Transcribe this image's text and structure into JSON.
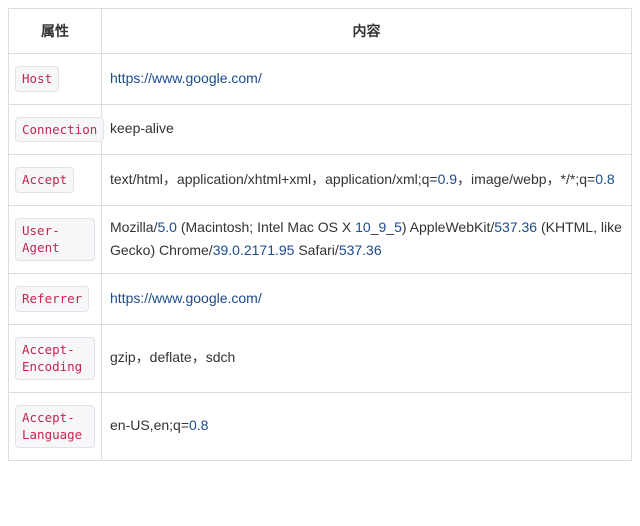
{
  "headers": {
    "attribute": "属性",
    "content": "内容"
  },
  "rows": [
    {
      "attr": "Host",
      "content": "https://www.google.com/",
      "isLink": true
    },
    {
      "attr": "Connection",
      "content": "keep-alive",
      "isLink": false
    },
    {
      "attr": "Accept",
      "content": "text/html，application/xhtml+xml，application/xml;q=0.9，image/webp，*/*;q=0.8",
      "isLink": false
    },
    {
      "attr": "User-Agent",
      "content": "Mozilla/5.0 (Macintosh; Intel Mac OS X 10_9_5) AppleWebKit/537.36 (KHTML, like Gecko) Chrome/39.0.2171.95 Safari/537.36",
      "isLink": false
    },
    {
      "attr": "Referrer",
      "content": "https://www.google.com/",
      "isLink": true
    },
    {
      "attr": "Accept-Encoding",
      "content": "gzip，deflate，sdch",
      "isLink": false
    },
    {
      "attr": "Accept-Language",
      "content": "en-US,en;q=0.8",
      "isLink": false
    }
  ]
}
